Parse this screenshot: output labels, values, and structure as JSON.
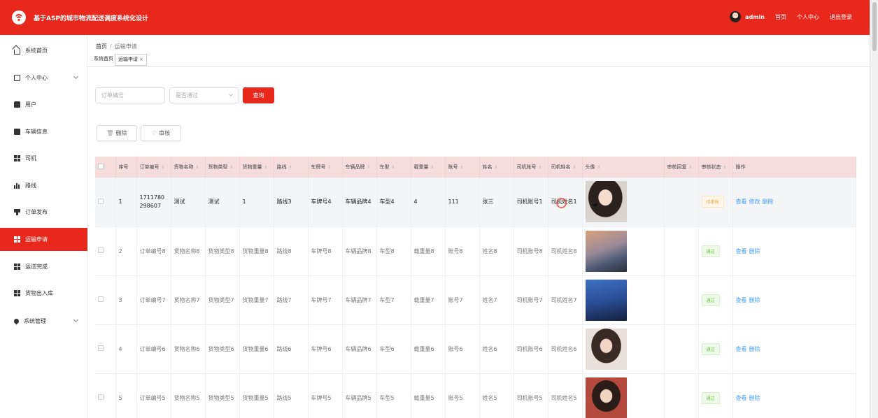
{
  "header": {
    "app_title": "基于ASP的城市物流配送调度系统化设计",
    "user": "admin",
    "links": [
      "首页",
      "个人中心",
      "退出登录"
    ]
  },
  "sidebar": {
    "items": [
      {
        "label": "系统首页",
        "icon": "home-icon"
      },
      {
        "label": "个人中心",
        "icon": "document-icon",
        "expandable": true
      },
      {
        "label": "用户",
        "icon": "user-icon"
      },
      {
        "label": "车辆信息",
        "icon": "clipboard-icon"
      },
      {
        "label": "司机",
        "icon": "grid-icon"
      },
      {
        "label": "路线",
        "icon": "bar-chart-icon"
      },
      {
        "label": "订单发布",
        "icon": "post-icon"
      },
      {
        "label": "运输申请",
        "icon": "grid-icon",
        "active": true
      },
      {
        "label": "运送完成",
        "icon": "grid-icon"
      },
      {
        "label": "货物出入库",
        "icon": "grid-icon"
      },
      {
        "label": "系统管理",
        "icon": "location-icon",
        "expandable": true
      }
    ]
  },
  "breadcrumb": {
    "home": "首页",
    "current": "运输申请"
  },
  "tabs": [
    {
      "label": "系统首页"
    },
    {
      "label": "运输申请",
      "closable": true
    }
  ],
  "search": {
    "order_placeholder": "订单编号",
    "pass_placeholder": "是否通过",
    "search_label": "查询"
  },
  "actions": {
    "delete_label": "删除",
    "audit_label": "审核"
  },
  "table": {
    "columns": [
      "序号",
      "订单编号",
      "货物名称",
      "货物类型",
      "货物重量",
      "路线",
      "车牌号",
      "车辆品牌",
      "车型",
      "载重量",
      "账号",
      "姓名",
      "司机账号",
      "司机姓名",
      "头像",
      "审核回复",
      "审核状态",
      "操作"
    ],
    "rows": [
      {
        "no": "1",
        "order": "1711780298607",
        "cargo_name": "测试",
        "cargo_type": "测试",
        "weight": "1",
        "route": "路线3",
        "plate": "车牌号4",
        "brand": "车辆品牌4",
        "model": "车型4",
        "load": "4",
        "account": "111",
        "name": "张三",
        "driver_acc": "司机账号1",
        "driver_name": "司机姓名1",
        "reply": "",
        "status": "待审核",
        "status_type": "wait",
        "ops": [
          "查看",
          "修改",
          "删除"
        ],
        "highlight": true
      },
      {
        "no": "2",
        "order": "订单编号8",
        "cargo_name": "货物名称8",
        "cargo_type": "货物类型8",
        "weight": "货物重量8",
        "route": "路线8",
        "plate": "车牌号8",
        "brand": "车辆品牌8",
        "model": "车型8",
        "load": "载重量8",
        "account": "账号8",
        "name": "姓名8",
        "driver_acc": "司机账号8",
        "driver_name": "司机姓名8",
        "reply": "",
        "status": "通过",
        "status_type": "ok",
        "ops": [
          "查看",
          "删除"
        ]
      },
      {
        "no": "3",
        "order": "订单编号7",
        "cargo_name": "货物名称7",
        "cargo_type": "货物类型7",
        "weight": "货物重量7",
        "route": "路线7",
        "plate": "车牌号7",
        "brand": "车辆品牌7",
        "model": "车型7",
        "load": "载重量7",
        "account": "账号7",
        "name": "姓名7",
        "driver_acc": "司机账号7",
        "driver_name": "司机姓名7",
        "reply": "",
        "status": "通过",
        "status_type": "ok",
        "ops": [
          "查看",
          "删除"
        ]
      },
      {
        "no": "4",
        "order": "订单编号6",
        "cargo_name": "货物名称6",
        "cargo_type": "货物类型6",
        "weight": "货物重量6",
        "route": "路线6",
        "plate": "车牌号6",
        "brand": "车辆品牌6",
        "model": "车型6",
        "load": "载重量6",
        "account": "账号6",
        "name": "姓名6",
        "driver_acc": "司机账号6",
        "driver_name": "司机姓名6",
        "reply": "",
        "status": "通过",
        "status_type": "ok",
        "ops": [
          "查看",
          "删除"
        ]
      },
      {
        "no": "5",
        "order": "订单编号5",
        "cargo_name": "货物名称5",
        "cargo_type": "货物类型5",
        "weight": "货物重量5",
        "route": "路线5",
        "plate": "车牌号5",
        "brand": "车辆品牌5",
        "model": "车型5",
        "load": "载重量5",
        "account": "账号5",
        "name": "姓名5",
        "driver_acc": "司机账号5",
        "driver_name": "司机姓名5",
        "reply": "",
        "status": "通过",
        "status_type": "ok",
        "ops": [
          "查看",
          "删除"
        ]
      }
    ]
  },
  "colors": {
    "primary": "#e8281c",
    "header_row": "#f5dcdd",
    "link": "#409eff"
  }
}
